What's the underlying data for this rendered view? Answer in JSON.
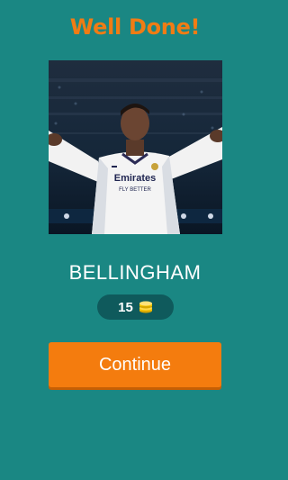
{
  "header": {
    "title": "Well Done!"
  },
  "photo": {
    "subject": "player-photo",
    "jersey_text": "Emirates",
    "jersey_subtext": "FLY BETTER"
  },
  "answer": {
    "text": "BELLINGHAM"
  },
  "reward": {
    "amount": "15",
    "icon": "coin-stack-icon",
    "icon_color": "#f5c400"
  },
  "actions": {
    "continue_label": "Continue"
  },
  "colors": {
    "background": "#1a8783",
    "accent": "#f07c14",
    "pill": "#0f5a5c"
  }
}
